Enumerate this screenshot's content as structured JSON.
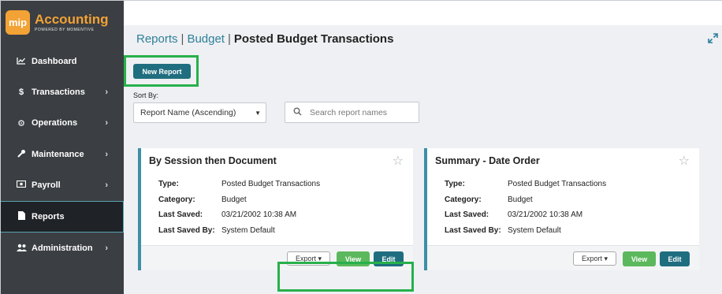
{
  "logo": {
    "badge": "mip",
    "title": "Accounting",
    "subtitle": "POWERED BY MOMENTIVE"
  },
  "sidebar": {
    "items": [
      {
        "label": "Dashboard",
        "icon": "chart-line-icon",
        "glyph": "📈"
      },
      {
        "label": "Transactions",
        "icon": "dollar-icon",
        "glyph": "$"
      },
      {
        "label": "Operations",
        "icon": "gears-icon",
        "glyph": "⚙"
      },
      {
        "label": "Maintenance",
        "icon": "wrench-icon",
        "glyph": "🔧"
      },
      {
        "label": "Payroll",
        "icon": "money-icon",
        "glyph": "▣"
      },
      {
        "label": "Reports",
        "icon": "file-icon",
        "glyph": "▮"
      },
      {
        "label": "Administration",
        "icon": "users-icon",
        "glyph": "👥"
      }
    ],
    "chevron": "›"
  },
  "breadcrumb": {
    "part1": "Reports",
    "part2": "Budget",
    "separator": "|",
    "current": "Posted Budget Transactions"
  },
  "toolbar": {
    "new_report_label": "New Report"
  },
  "sort": {
    "label": "Sort By:",
    "value": "Report Name (Ascending)"
  },
  "search": {
    "placeholder": "Search report names"
  },
  "cards": [
    {
      "title": "By Session then Document",
      "type_label": "Type:",
      "type": "Posted Budget Transactions",
      "category_label": "Category:",
      "category": "Budget",
      "last_saved_label": "Last Saved:",
      "last_saved": "03/21/2002 10:38 AM",
      "last_saved_by_label": "Last Saved By:",
      "last_saved_by": "System Default",
      "export_label": "Export ▾",
      "view_label": "View",
      "edit_label": "Edit"
    },
    {
      "title": "Summary - Date Order",
      "type_label": "Type:",
      "type": "Posted Budget Transactions",
      "category_label": "Category:",
      "category": "Budget",
      "last_saved_label": "Last Saved:",
      "last_saved": "03/21/2002 10:38 AM",
      "last_saved_by_label": "Last Saved By:",
      "last_saved_by": "System Default",
      "export_label": "Export ▾",
      "view_label": "View",
      "edit_label": "Edit"
    }
  ],
  "colors": {
    "accent": "#1f6e7f",
    "highlight": "#27b04b",
    "sidebar": "#3b3e42",
    "logo": "#f3a235"
  }
}
